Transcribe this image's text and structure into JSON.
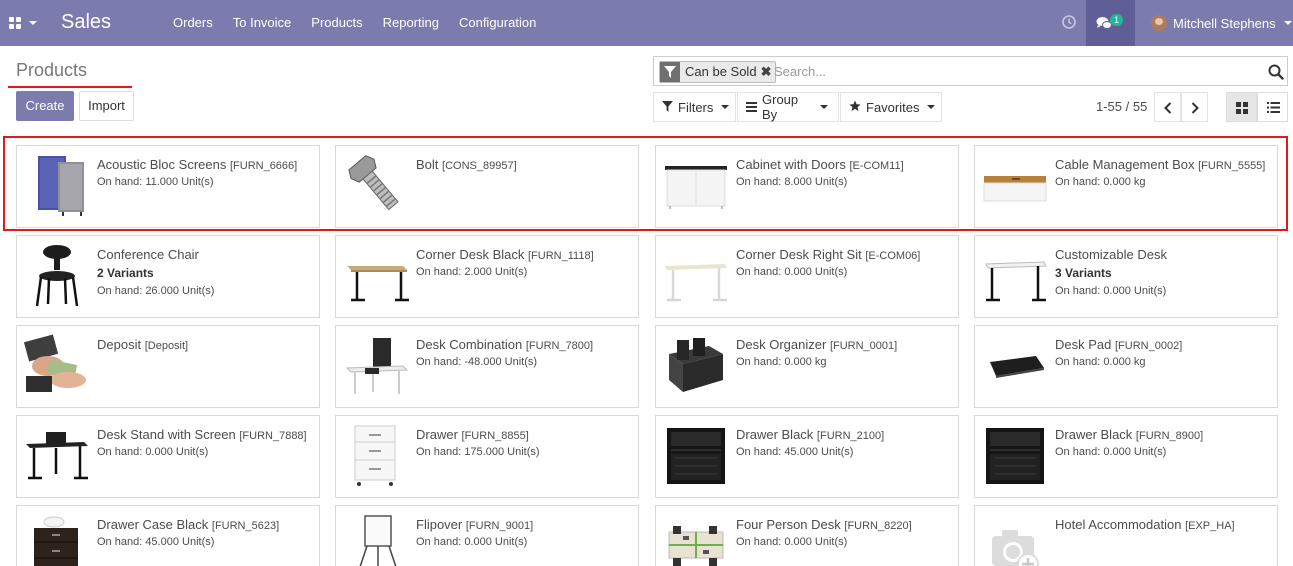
{
  "app": {
    "brand": "Sales"
  },
  "nav": {
    "menu": [
      "Orders",
      "To Invoice",
      "Products",
      "Reporting",
      "Configuration"
    ],
    "chat_count": "1",
    "user": "Mitchell Stephens"
  },
  "page": {
    "title": "Products"
  },
  "buttons": {
    "create": "Create",
    "import": "Import"
  },
  "search": {
    "facet": "Can be Sold",
    "placeholder": "Search..."
  },
  "filters": {
    "filters": "Filters",
    "group_by": "Group By",
    "favorites": "Favorites"
  },
  "pager": {
    "value": "1-55 / 55"
  },
  "colors": {
    "navbar": "#7c7bad",
    "accent": "#7c7bad",
    "highlight": "#e0191b"
  },
  "products": [
    {
      "name": "Acoustic Bloc Screens",
      "code": "[FURN_6666]",
      "variants": "",
      "onhand": "On hand: 11.000 Unit(s)",
      "image": "screens-image"
    },
    {
      "name": "Bolt",
      "code": "[CONS_89957]",
      "variants": "",
      "onhand": "",
      "image": "bolt-image"
    },
    {
      "name": "Cabinet with Doors",
      "code": "[E-COM11]",
      "variants": "",
      "onhand": "On hand: 8.000 Unit(s)",
      "image": "cabinet-image"
    },
    {
      "name": "Cable Management Box",
      "code": "[FURN_5555]",
      "variants": "",
      "onhand": "On hand: 0.000 kg",
      "image": "cable-box-image"
    },
    {
      "name": "Conference Chair",
      "code": "",
      "variants": "2 Variants",
      "onhand": "On hand: 26.000 Unit(s)",
      "image": "chair-image"
    },
    {
      "name": "Corner Desk Black",
      "code": "[FURN_1118]",
      "variants": "",
      "onhand": "On hand: 2.000 Unit(s)",
      "image": "desk-black-image"
    },
    {
      "name": "Corner Desk Right Sit",
      "code": "[E-COM06]",
      "variants": "",
      "onhand": "On hand: 0.000 Unit(s)",
      "image": "desk-right-image"
    },
    {
      "name": "Customizable Desk",
      "code": "",
      "variants": "3 Variants",
      "onhand": "On hand: 0.000 Unit(s)",
      "image": "custom-desk-image"
    },
    {
      "name": "Deposit",
      "code": "[Deposit]",
      "variants": "",
      "onhand": "",
      "image": "deposit-image"
    },
    {
      "name": "Desk Combination",
      "code": "[FURN_7800]",
      "variants": "",
      "onhand": "On hand: -48.000 Unit(s)",
      "image": "desk-combo-image"
    },
    {
      "name": "Desk Organizer",
      "code": "[FURN_0001]",
      "variants": "",
      "onhand": "On hand: 0.000 kg",
      "image": "organizer-image"
    },
    {
      "name": "Desk Pad",
      "code": "[FURN_0002]",
      "variants": "",
      "onhand": "On hand: 0.000 kg",
      "image": "desk-pad-image"
    },
    {
      "name": "Desk Stand with Screen",
      "code": "[FURN_7888]",
      "variants": "",
      "onhand": "On hand: 0.000 Unit(s)",
      "image": "desk-stand-image"
    },
    {
      "name": "Drawer",
      "code": "[FURN_8855]",
      "variants": "",
      "onhand": "On hand: 175.000 Unit(s)",
      "image": "drawer-white-image"
    },
    {
      "name": "Drawer Black",
      "code": "[FURN_2100]",
      "variants": "",
      "onhand": "On hand: 45.000 Unit(s)",
      "image": "drawer-black-image"
    },
    {
      "name": "Drawer Black",
      "code": "[FURN_8900]",
      "variants": "",
      "onhand": "On hand: 0.000 Unit(s)",
      "image": "drawer-black-image"
    },
    {
      "name": "Drawer Case Black",
      "code": "[FURN_5623]",
      "variants": "",
      "onhand": "On hand: 45.000 Unit(s)",
      "image": "drawer-case-image"
    },
    {
      "name": "Flipover",
      "code": "[FURN_9001]",
      "variants": "",
      "onhand": "On hand: 0.000 Unit(s)",
      "image": "flipover-image"
    },
    {
      "name": "Four Person Desk",
      "code": "[FURN_8220]",
      "variants": "",
      "onhand": "On hand: 0.000 Unit(s)",
      "image": "four-desk-image"
    },
    {
      "name": "Hotel Accommodation",
      "code": "[EXP_HA]",
      "variants": "",
      "onhand": "",
      "image": "placeholder-camera-image"
    }
  ]
}
